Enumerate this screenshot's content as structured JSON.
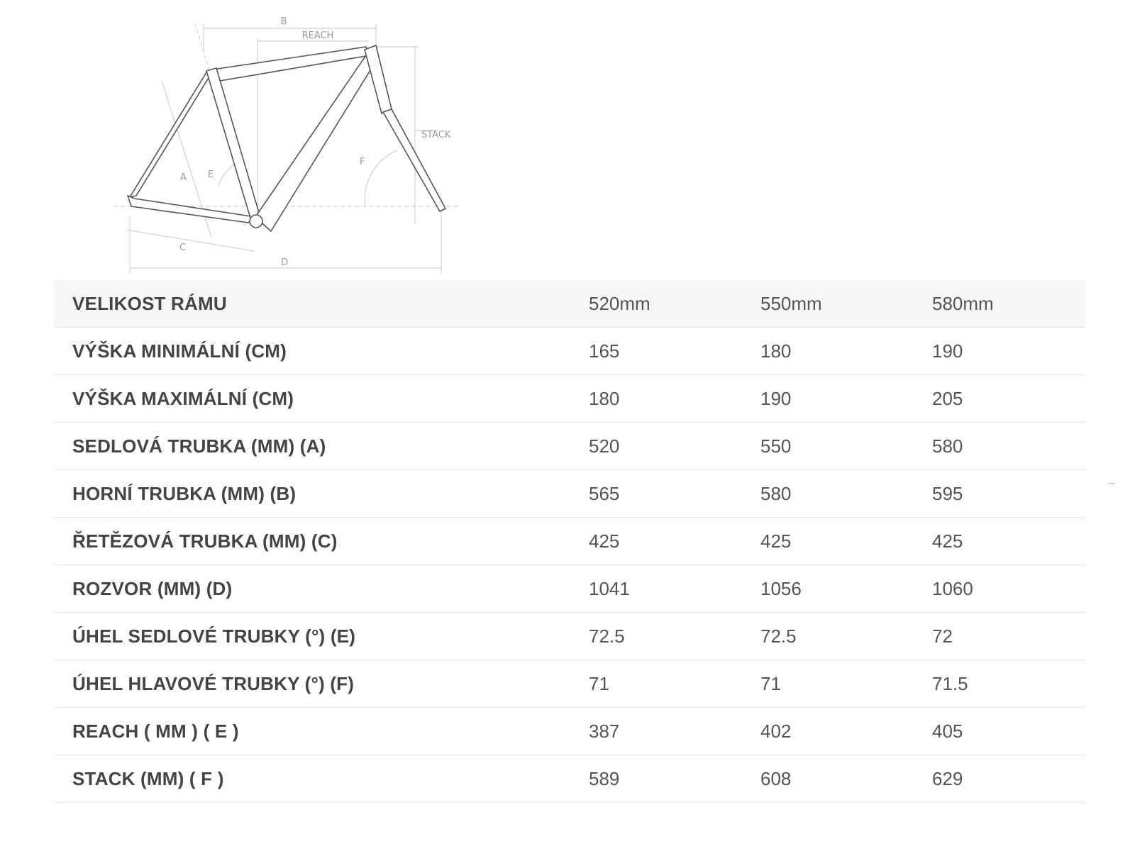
{
  "diagram": {
    "labels": {
      "a": "A",
      "b": "B",
      "c": "C",
      "d": "D",
      "e": "E",
      "f": "F",
      "reach": "REACH",
      "stack": "STACK"
    }
  },
  "table": {
    "header": {
      "label": "VELIKOST RÁMU",
      "values": [
        "520mm",
        "550mm",
        "580mm"
      ]
    },
    "rows": [
      {
        "label": "VÝŠKA MINIMÁLNÍ (CM)",
        "values": [
          "165",
          "180",
          "190"
        ]
      },
      {
        "label": "VÝŠKA MAXIMÁLNÍ (CM)",
        "values": [
          "180",
          "190",
          "205"
        ]
      },
      {
        "label": "SEDLOVÁ TRUBKA (MM) (A)",
        "values": [
          "520",
          "550",
          "580"
        ]
      },
      {
        "label": "HORNÍ TRUBKA (MM) (B)",
        "values": [
          "565",
          "580",
          "595"
        ]
      },
      {
        "label": "ŘETĚZOVÁ TRUBKA (MM) (C)",
        "values": [
          "425",
          "425",
          "425"
        ]
      },
      {
        "label": "ROZVOR (MM) (D)",
        "values": [
          "1041",
          "1056",
          "1060"
        ]
      },
      {
        "label": "ÚHEL SEDLOVÉ TRUBKY (°) (E)",
        "values": [
          "72.5",
          "72.5",
          "72"
        ]
      },
      {
        "label": "ÚHEL HLAVOVÉ TRUBKY (°) (F)",
        "values": [
          "71",
          "71",
          "71.5"
        ]
      },
      {
        "label": "REACH ( MM ) ( E )",
        "values": [
          "387",
          "402",
          "405"
        ]
      },
      {
        "label": "STACK (MM) ( F )",
        "values": [
          "589",
          "608",
          "629"
        ]
      }
    ]
  }
}
